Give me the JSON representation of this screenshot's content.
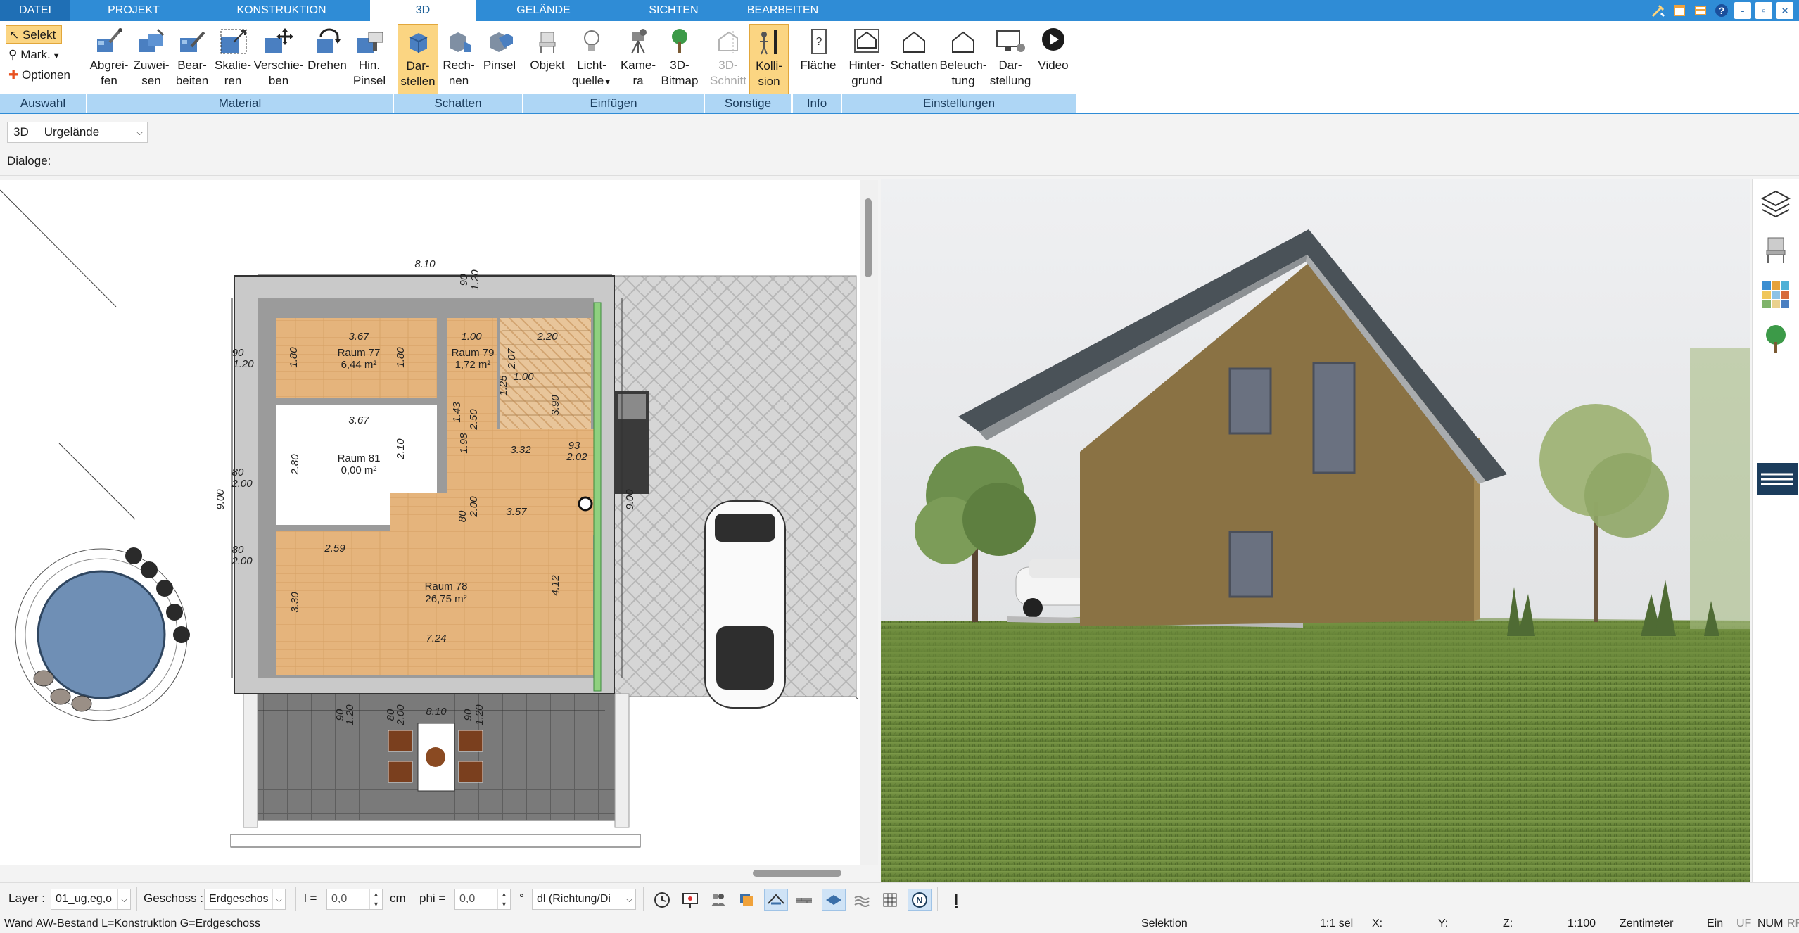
{
  "tabs": [
    {
      "label": "DATEI"
    },
    {
      "label": "PROJEKT"
    },
    {
      "label": "KONSTRUKTION"
    },
    {
      "label": "3D"
    },
    {
      "label": "GELÄNDE"
    },
    {
      "label": "SICHTEN"
    },
    {
      "label": "BEARBEITEN"
    }
  ],
  "window_controls": [
    "tools-icon",
    "window-icon",
    "layout-icon",
    "help-icon",
    "minimize-icon",
    "restore-icon",
    "close-icon"
  ],
  "ribbon": {
    "auswahl": {
      "label": "Auswahl",
      "selekt": "Selekt",
      "mark": "Mark.",
      "optionen": "Optionen"
    },
    "material": {
      "label": "Material",
      "buttons": [
        {
          "l1": "Abgrei-",
          "l2": "fen",
          "icon": "eyedropper-icon"
        },
        {
          "l1": "Zuwei-",
          "l2": "sen",
          "icon": "assign-icon"
        },
        {
          "l1": "Bear-",
          "l2": "beiten",
          "icon": "edit-material-icon"
        },
        {
          "l1": "Skalie-",
          "l2": "ren",
          "icon": "scale-icon"
        },
        {
          "l1": "Verschie-",
          "l2": "ben",
          "icon": "move-icon"
        },
        {
          "l1": "Drehen",
          "l2": "",
          "icon": "rotate-icon"
        },
        {
          "l1": "Hin.",
          "l2": "Pinsel",
          "icon": "brush-icon"
        }
      ]
    },
    "schatten": {
      "label": "Schatten",
      "buttons": [
        {
          "l1": "Dar-",
          "l2": "stellen",
          "icon": "display-shadow-icon"
        },
        {
          "l1": "Rech-",
          "l2": "nen",
          "icon": "calculate-shadow-icon"
        },
        {
          "l1": "Pinsel",
          "l2": "",
          "icon": "shadow-brush-icon"
        }
      ]
    },
    "einfuegen": {
      "label": "Einfügen",
      "buttons": [
        {
          "l1": "Objekt",
          "l2": "",
          "icon": "chair-icon"
        },
        {
          "l1": "Licht-",
          "l2": "quelle",
          "icon": "lightbulb-icon"
        },
        {
          "l1": "Kame-",
          "l2": "ra",
          "icon": "camera-icon"
        },
        {
          "l1": "3D-",
          "l2": "Bitmap",
          "icon": "tree-icon"
        }
      ]
    },
    "sonstige": {
      "label": "Sonstige",
      "buttons": [
        {
          "l1": "3D-",
          "l2": "Schnitt",
          "icon": "section-icon"
        },
        {
          "l1": "Kolli-",
          "l2": "sion",
          "icon": "collision-icon"
        }
      ]
    },
    "info": {
      "label": "Info",
      "buttons": [
        {
          "l1": "Fläche",
          "l2": "",
          "icon": "area-info-icon"
        }
      ]
    },
    "einstellungen": {
      "label": "Einstellungen",
      "buttons": [
        {
          "l1": "Hinter-",
          "l2": "grund",
          "icon": "background-icon"
        },
        {
          "l1": "Schatten",
          "l2": "",
          "icon": "house-shadow-icon"
        },
        {
          "l1": "Beleuch-",
          "l2": "tung",
          "icon": "lighting-icon"
        },
        {
          "l1": "Dar-",
          "l2": "stellung",
          "icon": "monitor-icon"
        },
        {
          "l1": "Video",
          "l2": "",
          "icon": "play-icon"
        }
      ]
    }
  },
  "row3d": {
    "label": "3D",
    "select": "Urgelände"
  },
  "dialogs": {
    "label": "Dialoge:"
  },
  "plan": {
    "dims": {
      "top_width": "8.10",
      "bottom_width": "8.10",
      "left_height": "9.00",
      "right_height": "9.00",
      "t90": "90",
      "t120": "1.20",
      "r367a": "3.67",
      "r100": "1.00",
      "r220": "2.20",
      "r180a": "1.80",
      "r180b": "1.80",
      "l90": "90",
      "l120": "1.20",
      "r367b": "3.67",
      "r280": "2.80",
      "r210": "2.10",
      "l80a": "80",
      "l200a": "2.00",
      "r357": "3.57",
      "r259": "2.59",
      "l80b": "80",
      "l200b": "2.00",
      "r330": "3.30",
      "r412": "4.12",
      "r724": "7.24",
      "b90": "90",
      "b120a": "1.20",
      "b80": "80",
      "b200": "2.00",
      "b90b": "90",
      "b120b": "1.20",
      "r93": "93",
      "r202": "2.02",
      "r532": "3.32",
      "r390": "3.90",
      "r80c": "80",
      "r200c": "2.00",
      "s198": "1.98",
      "s250": "2.50",
      "s143": "1.43",
      "s100": "1.00",
      "s125": "1.25",
      "s207": "2.07"
    },
    "rooms": [
      {
        "name": "Raum 77",
        "area": "6,44 m²"
      },
      {
        "name": "Raum 79",
        "area": "1,72 m²"
      },
      {
        "name": "Raum 81",
        "area": "0,00 m²"
      },
      {
        "name": "Raum 78",
        "area": "26,75 m²"
      }
    ]
  },
  "bottombar": {
    "layer_label": "Layer :",
    "layer_value": "01_ug,eg,o",
    "geschoss_label": "Geschoss :",
    "geschoss_value": "Erdgeschos",
    "l_label": "l =",
    "l_value": "0,0",
    "l_unit": "cm",
    "phi_label": "phi =",
    "phi_value": "0,0",
    "phi_unit": "°",
    "direction_value": "dl (Richtung/Di",
    "tools": [
      "clock-icon",
      "presentation-icon",
      "users-icon",
      "layers-stack-icon",
      "roof-icon",
      "brick-icon",
      "plane-icon",
      "water-icon",
      "grid-icon",
      "north-icon",
      "more-icon"
    ]
  },
  "status": {
    "left": "Wand AW-Bestand L=Konstruktion G=Erdgeschoss",
    "mode": "Selektion",
    "sel": "1:1 sel",
    "x": "X:",
    "y": "Y:",
    "z": "Z:",
    "scale": "1:100",
    "unit": "Zentimeter",
    "ein": "Ein",
    "uf": "UF",
    "num": "NUM",
    "rf": "RF"
  },
  "colors": {
    "accent": "#2f8cd6",
    "group_label": "#aed6f5",
    "active": "#fbd582",
    "floor_wood": "#e5b47c",
    "wall": "#9b9b9b",
    "facade": "#8a7244",
    "roof": "#4a5258",
    "grass": "#6c8a3e",
    "sky": "#e9eaec"
  }
}
